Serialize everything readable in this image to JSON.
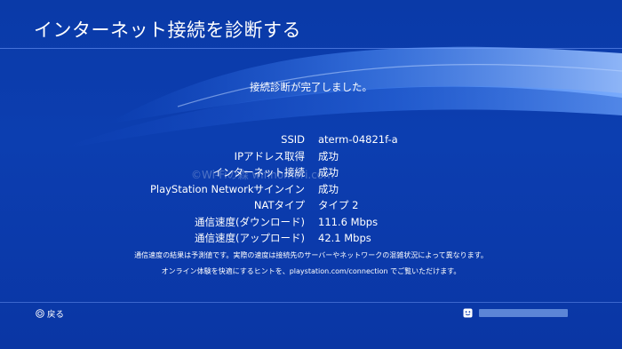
{
  "screen": {
    "title": "インターネット接続を診断する",
    "status": "接続診断が完了しました。"
  },
  "results": [
    {
      "label": "SSID",
      "value": "aterm-04821f-a"
    },
    {
      "label": "IPアドレス取得",
      "value": "成功"
    },
    {
      "label": "インターネット接続",
      "value": "成功"
    },
    {
      "label": "PlayStation Networkサインイン",
      "value": "成功"
    },
    {
      "label": "NATタイプ",
      "value": "タイプ 2"
    },
    {
      "label": "通信速度(ダウンロード)",
      "value": "111.6 Mbps"
    },
    {
      "label": "通信速度(アップロード)",
      "value": "42.1 Mbps"
    }
  ],
  "notes": {
    "speed_note": "通信速度の結果は予測値です。実際の速度は接続先のサーバーやネットワークの混雑状況によって異なります。",
    "hint_note": "オンライン体験を快適にするヒントを、playstation.com/connection でご覧いただけます。"
  },
  "watermark": "©Wi-Fiの森 wifinomori.com",
  "footer": {
    "back_label": "戻る",
    "back_icon": "circle-button-icon",
    "user_icon": "user-face-icon"
  },
  "colors": {
    "background": "#0c3eb0",
    "text": "#ffffff"
  }
}
